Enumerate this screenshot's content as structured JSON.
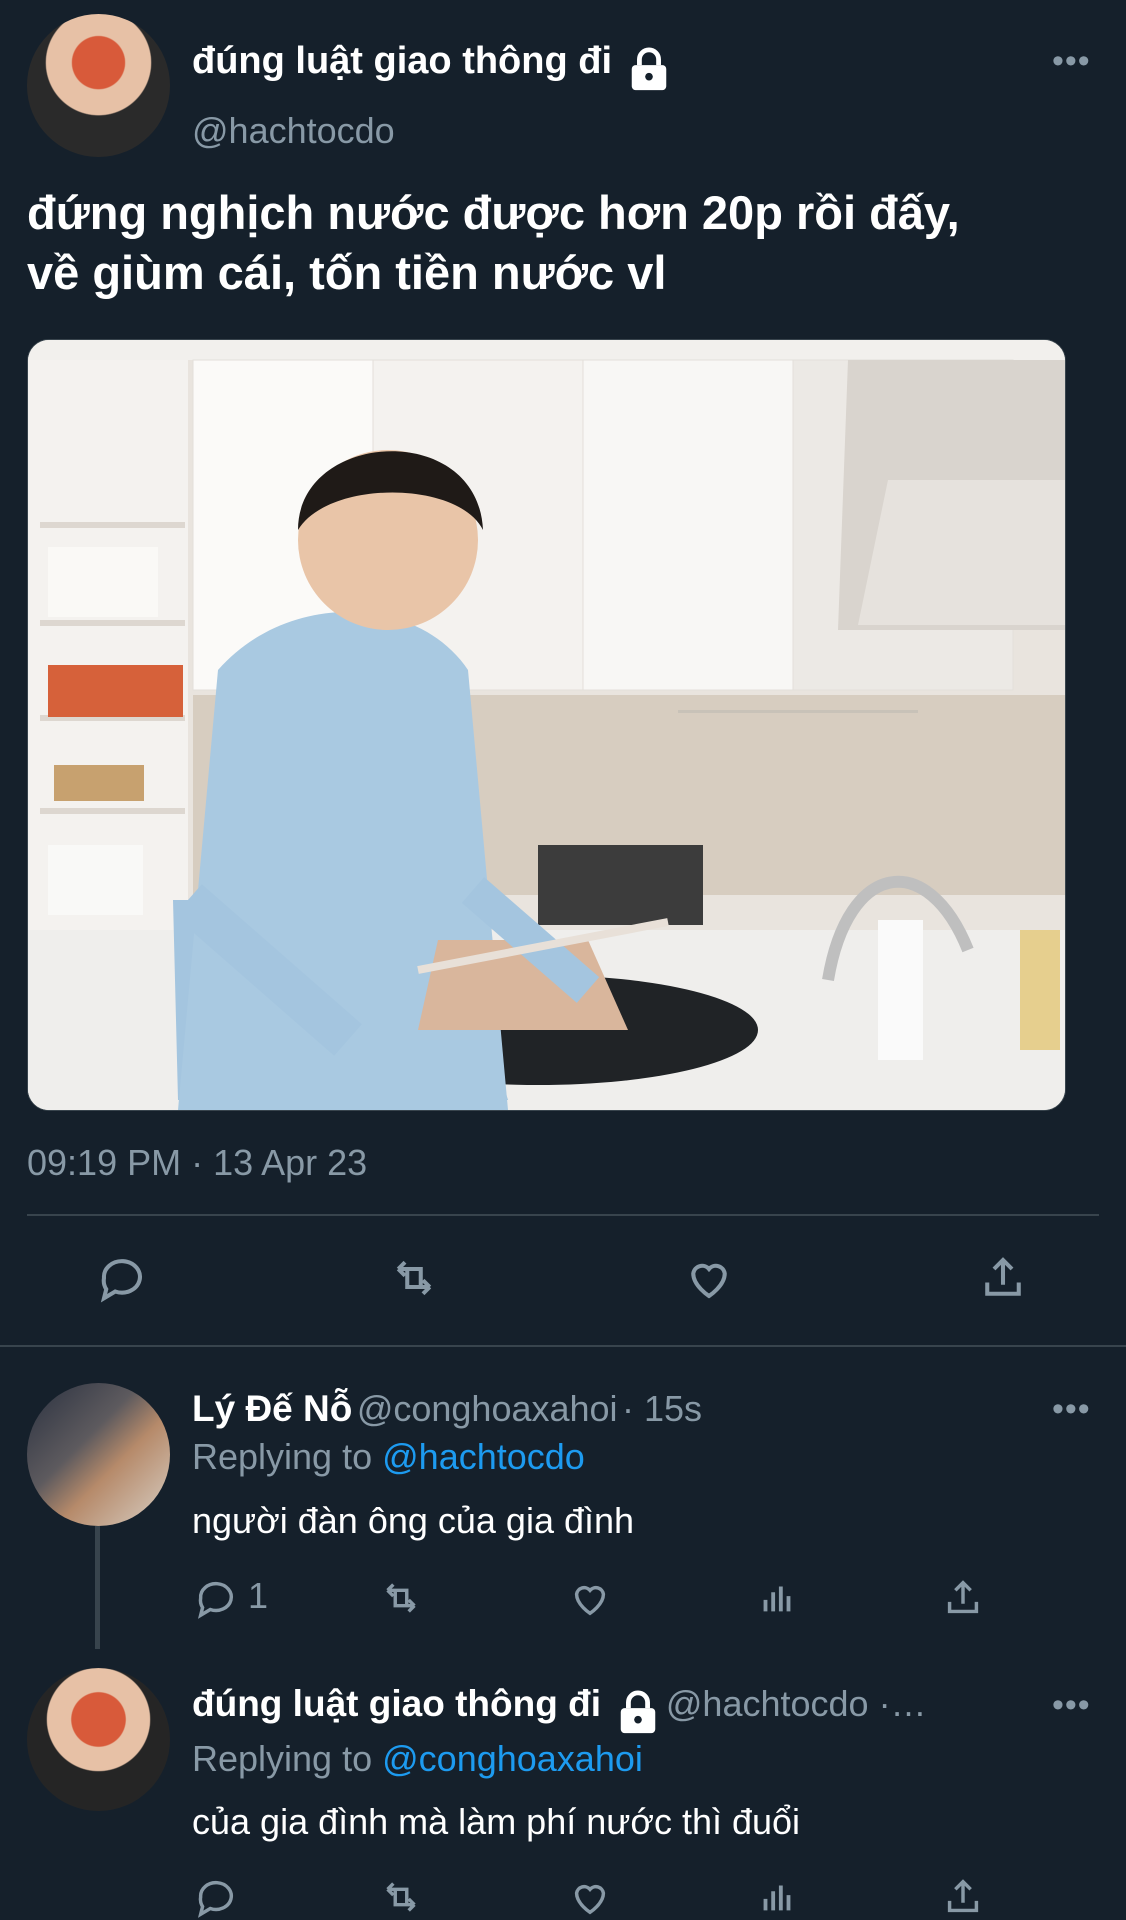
{
  "main_tweet": {
    "display_name": "đúng luật giao thông đi",
    "handle": "@hachtocdo",
    "text_line1": "đứng nghịch nước được hơn 20p rồi đấy,",
    "text_line2": "về giùm cái, tốn tiền nước vl",
    "timestamp": "09:19 PM · 13 Apr 23",
    "more": "•••"
  },
  "reply1": {
    "display_name": "Lý Đế Nỗ",
    "handle": "@conghoaxahoi",
    "time": "· 15s",
    "replying_label": "Replying to",
    "replying_to": "@hachtocdo",
    "text": "người đàn ông của gia đình",
    "reply_count": "1",
    "more": "•••"
  },
  "reply2": {
    "display_name": "đúng luật giao thông đi",
    "handle": "@hachtocdo ·…",
    "replying_label": "Replying to",
    "replying_to": "@conghoaxahoi",
    "text": "của gia đình mà làm phí nước thì đuổi",
    "more": "•••"
  },
  "icons": {
    "lock": "lock-icon",
    "reply": "comment-icon",
    "retweet": "retweet-icon",
    "like": "heart-icon",
    "share": "share-icon",
    "analytics": "analytics-icon"
  },
  "colors": {
    "background": "#15202b",
    "text_secondary": "#8899a6",
    "accent": "#1d9bf0",
    "divider": "#38444d"
  }
}
